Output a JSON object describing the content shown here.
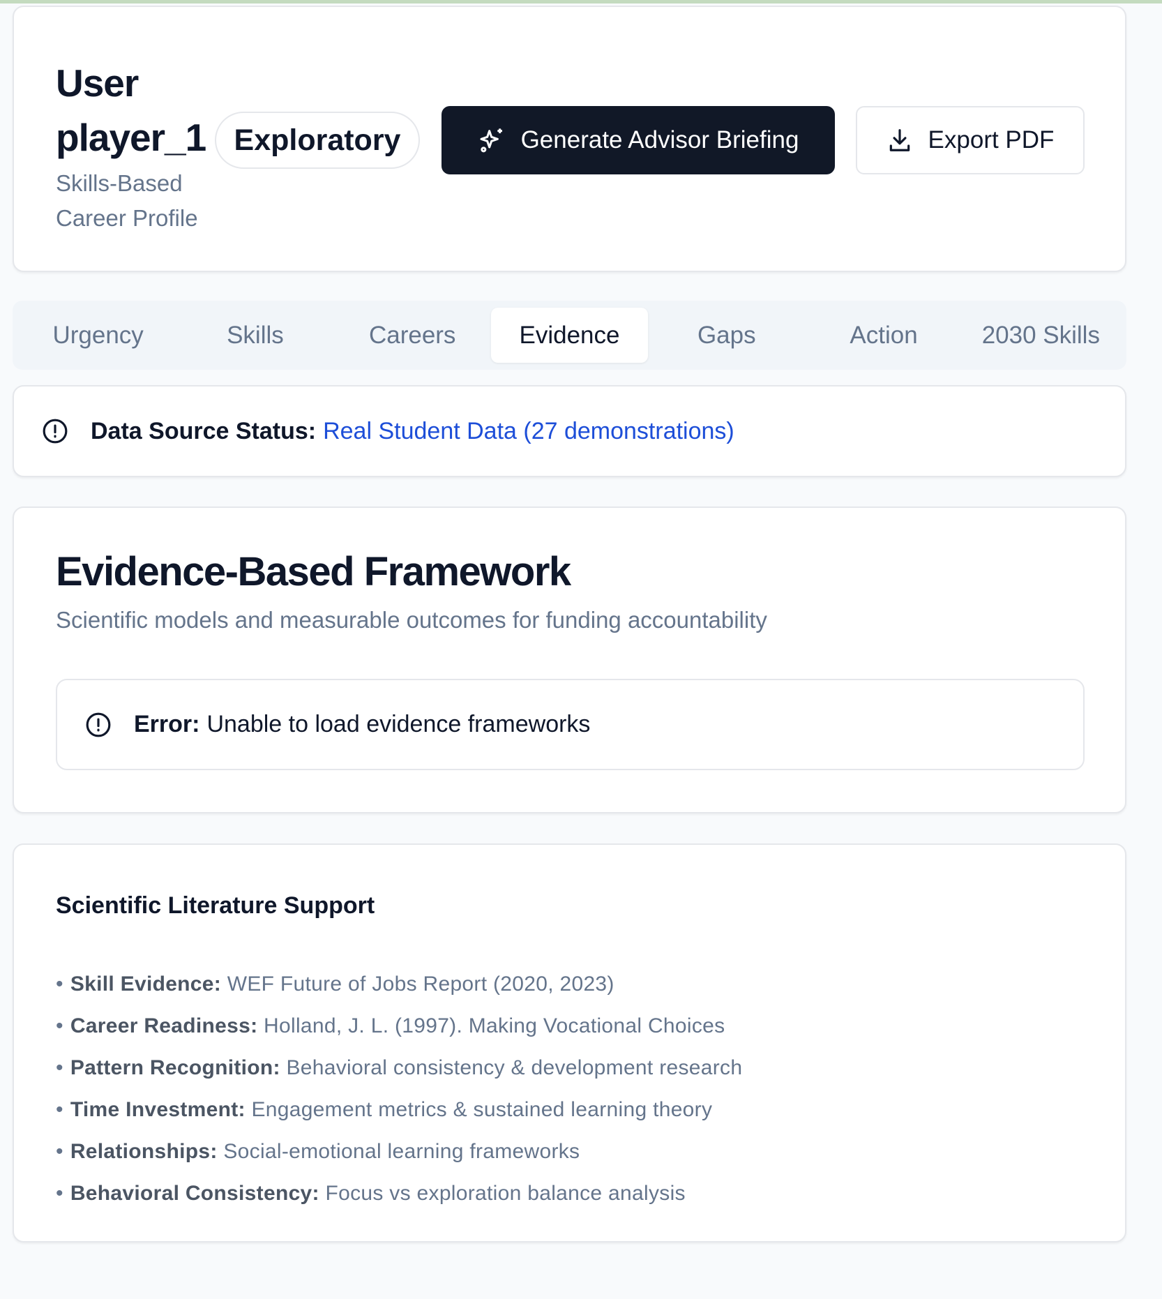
{
  "header": {
    "title": "User player_1",
    "subtitle": "Skills-Based Career Profile",
    "badge": "Exploratory",
    "generate_label": "Generate Advisor Briefing",
    "export_label": "Export PDF"
  },
  "tabs": [
    {
      "label": "Urgency"
    },
    {
      "label": "Skills"
    },
    {
      "label": "Careers"
    },
    {
      "label": "Evidence",
      "active": true
    },
    {
      "label": "Gaps"
    },
    {
      "label": "Action"
    },
    {
      "label": "2030 Skills"
    }
  ],
  "status": {
    "label": "Data Source Status:",
    "value": "Real Student Data (27 demonstrations)",
    "value_color": "#1d4ed8"
  },
  "evidence": {
    "title": "Evidence-Based Framework",
    "subtitle": "Scientific models and measurable outcomes for funding accountability",
    "error_label": "Error:",
    "error_message": "Unable to load evidence frameworks"
  },
  "literature": {
    "title": "Scientific Literature Support",
    "items": [
      {
        "label": "Skill Evidence:",
        "text": "WEF Future of Jobs Report (2020, 2023)"
      },
      {
        "label": "Career Readiness:",
        "text": "Holland, J. L. (1997). Making Vocational Choices"
      },
      {
        "label": "Pattern Recognition:",
        "text": "Behavioral consistency & development research"
      },
      {
        "label": "Time Investment:",
        "text": "Engagement metrics & sustained learning theory"
      },
      {
        "label": "Relationships:",
        "text": "Social-emotional learning frameworks"
      },
      {
        "label": "Behavioral Consistency:",
        "text": "Focus vs exploration balance analysis"
      }
    ]
  }
}
